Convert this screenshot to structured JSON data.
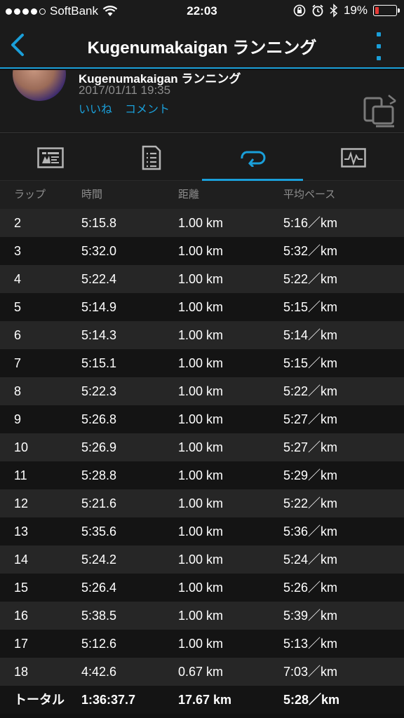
{
  "status_bar": {
    "carrier": "SoftBank",
    "time": "22:03",
    "battery_text": "19%",
    "battery_level": 0.19,
    "signal_bars_filled": 4,
    "signal_bars_total": 5
  },
  "nav": {
    "title": "Kugenumakaigan ランニング"
  },
  "activity": {
    "name": "Kugenumakaigan ランニング",
    "date": "2017/01/11 19:35",
    "like_label": "いいね",
    "comment_label": "コメント"
  },
  "tabs": [
    {
      "icon": "chart-summary-icon",
      "active": false
    },
    {
      "icon": "details-document-icon",
      "active": false
    },
    {
      "icon": "laps-loop-icon",
      "active": true
    },
    {
      "icon": "graph-monitor-icon",
      "active": false
    }
  ],
  "colors": {
    "accent": "#1a9fd9",
    "battery_low": "#e53935"
  },
  "laps": {
    "headers": [
      "ラップ",
      "時間",
      "距離",
      "平均ペース"
    ],
    "rows": [
      {
        "lap": "2",
        "time": "5:15.8",
        "distance": "1.00 km",
        "pace": "5:16／km"
      },
      {
        "lap": "3",
        "time": "5:32.0",
        "distance": "1.00 km",
        "pace": "5:32／km"
      },
      {
        "lap": "4",
        "time": "5:22.4",
        "distance": "1.00 km",
        "pace": "5:22／km"
      },
      {
        "lap": "5",
        "time": "5:14.9",
        "distance": "1.00 km",
        "pace": "5:15／km"
      },
      {
        "lap": "6",
        "time": "5:14.3",
        "distance": "1.00 km",
        "pace": "5:14／km"
      },
      {
        "lap": "7",
        "time": "5:15.1",
        "distance": "1.00 km",
        "pace": "5:15／km"
      },
      {
        "lap": "8",
        "time": "5:22.3",
        "distance": "1.00 km",
        "pace": "5:22／km"
      },
      {
        "lap": "9",
        "time": "5:26.8",
        "distance": "1.00 km",
        "pace": "5:27／km"
      },
      {
        "lap": "10",
        "time": "5:26.9",
        "distance": "1.00 km",
        "pace": "5:27／km"
      },
      {
        "lap": "11",
        "time": "5:28.8",
        "distance": "1.00 km",
        "pace": "5:29／km"
      },
      {
        "lap": "12",
        "time": "5:21.6",
        "distance": "1.00 km",
        "pace": "5:22／km"
      },
      {
        "lap": "13",
        "time": "5:35.6",
        "distance": "1.00 km",
        "pace": "5:36／km"
      },
      {
        "lap": "14",
        "time": "5:24.2",
        "distance": "1.00 km",
        "pace": "5:24／km"
      },
      {
        "lap": "15",
        "time": "5:26.4",
        "distance": "1.00 km",
        "pace": "5:26／km"
      },
      {
        "lap": "16",
        "time": "5:38.5",
        "distance": "1.00 km",
        "pace": "5:39／km"
      },
      {
        "lap": "17",
        "time": "5:12.6",
        "distance": "1.00 km",
        "pace": "5:13／km"
      },
      {
        "lap": "18",
        "time": "4:42.6",
        "distance": "0.67 km",
        "pace": "7:03／km"
      }
    ],
    "total": {
      "lap": "トータル",
      "time": "1:36:37.7",
      "distance": "17.67 km",
      "pace": "5:28／km"
    }
  }
}
